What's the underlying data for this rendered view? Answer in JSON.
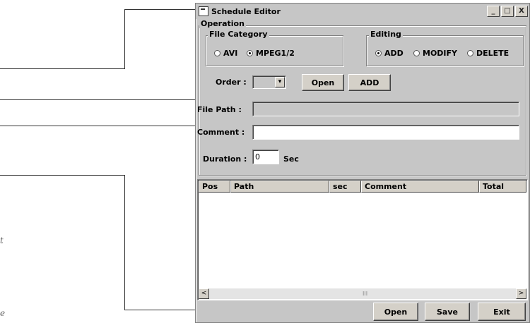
{
  "window": {
    "title": "Schedule Editor",
    "controls": [
      "_",
      "□",
      "X"
    ]
  },
  "operation": {
    "label": "Operation",
    "file_category": {
      "label": "File Category",
      "options": [
        {
          "label": "AVI",
          "checked": false
        },
        {
          "label": "MPEG1/2",
          "checked": true
        }
      ]
    },
    "editing": {
      "label": "Editing",
      "options": [
        {
          "label": "ADD",
          "checked": true
        },
        {
          "label": "MODIFY",
          "checked": false
        },
        {
          "label": "DELETE",
          "checked": false
        }
      ]
    },
    "order_label": "Order :",
    "order_value": "",
    "open_button": "Open",
    "add_button": "ADD",
    "file_path_label": "File Path :",
    "file_path_value": "",
    "comment_label": "Comment :",
    "comment_value": "",
    "duration_label": "Duration :",
    "duration_value": "0",
    "duration_unit": "Sec"
  },
  "table": {
    "columns": [
      "Pos",
      "Path",
      "sec",
      "Comment",
      "Total"
    ],
    "rows": [],
    "scroll_left": "<",
    "scroll_right": ">",
    "scroll_mark": "III"
  },
  "footer": {
    "open": "Open",
    "save": "Save",
    "exit": "Exit"
  },
  "margin_chars": [
    "t",
    "e"
  ]
}
